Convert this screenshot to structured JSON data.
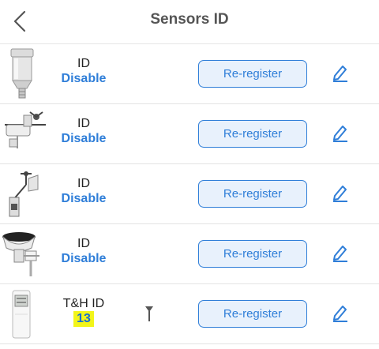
{
  "header": {
    "title": "Sensors ID",
    "back_icon": "chevron-left-icon"
  },
  "accent_color": "#2f7ed8",
  "sensors": [
    {
      "id_label": "ID",
      "id_value": "Disable",
      "button_label": "Re-register",
      "image": "rain-gauge-sensor"
    },
    {
      "id_label": "ID",
      "id_value": "Disable",
      "button_label": "Re-register",
      "image": "5-in-1-weather-station-sensor"
    },
    {
      "id_label": "ID",
      "id_value": "Disable",
      "button_label": "Re-register",
      "image": "wind-sensor-array"
    },
    {
      "id_label": "ID",
      "id_value": "Disable",
      "button_label": "Re-register",
      "image": "rain-collector-sensor"
    },
    {
      "id_label": "T&H ID",
      "id_value": "13",
      "button_label": "Re-register",
      "image": "thermo-hygro-sensor",
      "signal_icon": "antenna-icon"
    }
  ]
}
